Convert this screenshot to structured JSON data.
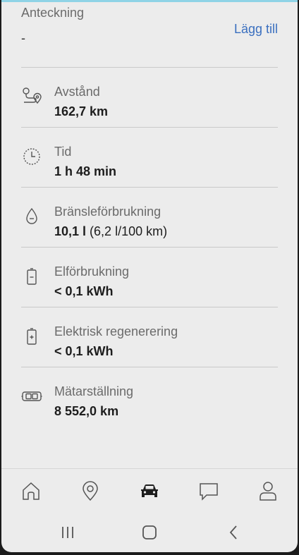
{
  "note": {
    "label": "Anteckning",
    "value": "-",
    "add_label": "Lägg till"
  },
  "stats": [
    {
      "icon": "route-icon",
      "label": "Avstånd",
      "value_bold": "162,7 km",
      "value_extra": ""
    },
    {
      "icon": "clock-icon",
      "label": "Tid",
      "value_bold": "1 h 48 min",
      "value_extra": ""
    },
    {
      "icon": "fuel-drop-icon",
      "label": "Bränsleförbrukning",
      "value_bold": "10,1 l",
      "value_extra": " (6,2 l/100 km)"
    },
    {
      "icon": "battery-minus-icon",
      "label": "Elförbrukning",
      "value_bold": "< 0,1 kWh",
      "value_extra": ""
    },
    {
      "icon": "battery-plus-icon",
      "label": "Elektrisk regenerering",
      "value_bold": "< 0,1 kWh",
      "value_extra": ""
    },
    {
      "icon": "odometer-icon",
      "label": "Mätarställning",
      "value_bold": "8 552,0 km",
      "value_extra": ""
    }
  ],
  "nav": {
    "items": [
      "home-icon",
      "map-pin-icon",
      "car-icon",
      "chat-icon",
      "profile-icon"
    ],
    "active": "car-icon"
  },
  "colors": {
    "accent": "#3a6fbf",
    "background": "#ececec",
    "icon": "#555555",
    "active_icon": "#1d1d1d"
  }
}
